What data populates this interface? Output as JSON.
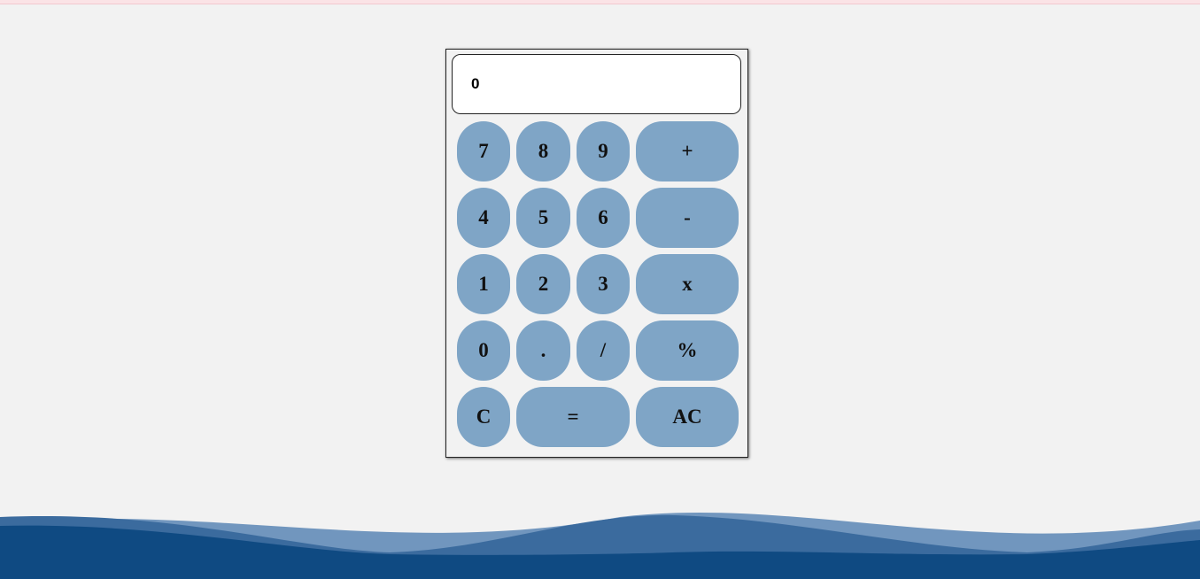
{
  "display": {
    "value": "0"
  },
  "buttons": {
    "seven": "7",
    "eight": "8",
    "nine": "9",
    "plus": "+",
    "four": "4",
    "five": "5",
    "six": "6",
    "minus": "-",
    "one": "1",
    "two": "2",
    "three": "3",
    "multiply": "x",
    "zero": "0",
    "decimal": ".",
    "divide": "/",
    "percent": "%",
    "clear": "C",
    "equals": "=",
    "all_clear": "AC"
  },
  "colors": {
    "background": "#f2f2f2",
    "button": "#7fa5c6",
    "wave_dark": "#0f4a82",
    "wave_mid": "#3b6b9e",
    "wave_light": "#7196be"
  }
}
